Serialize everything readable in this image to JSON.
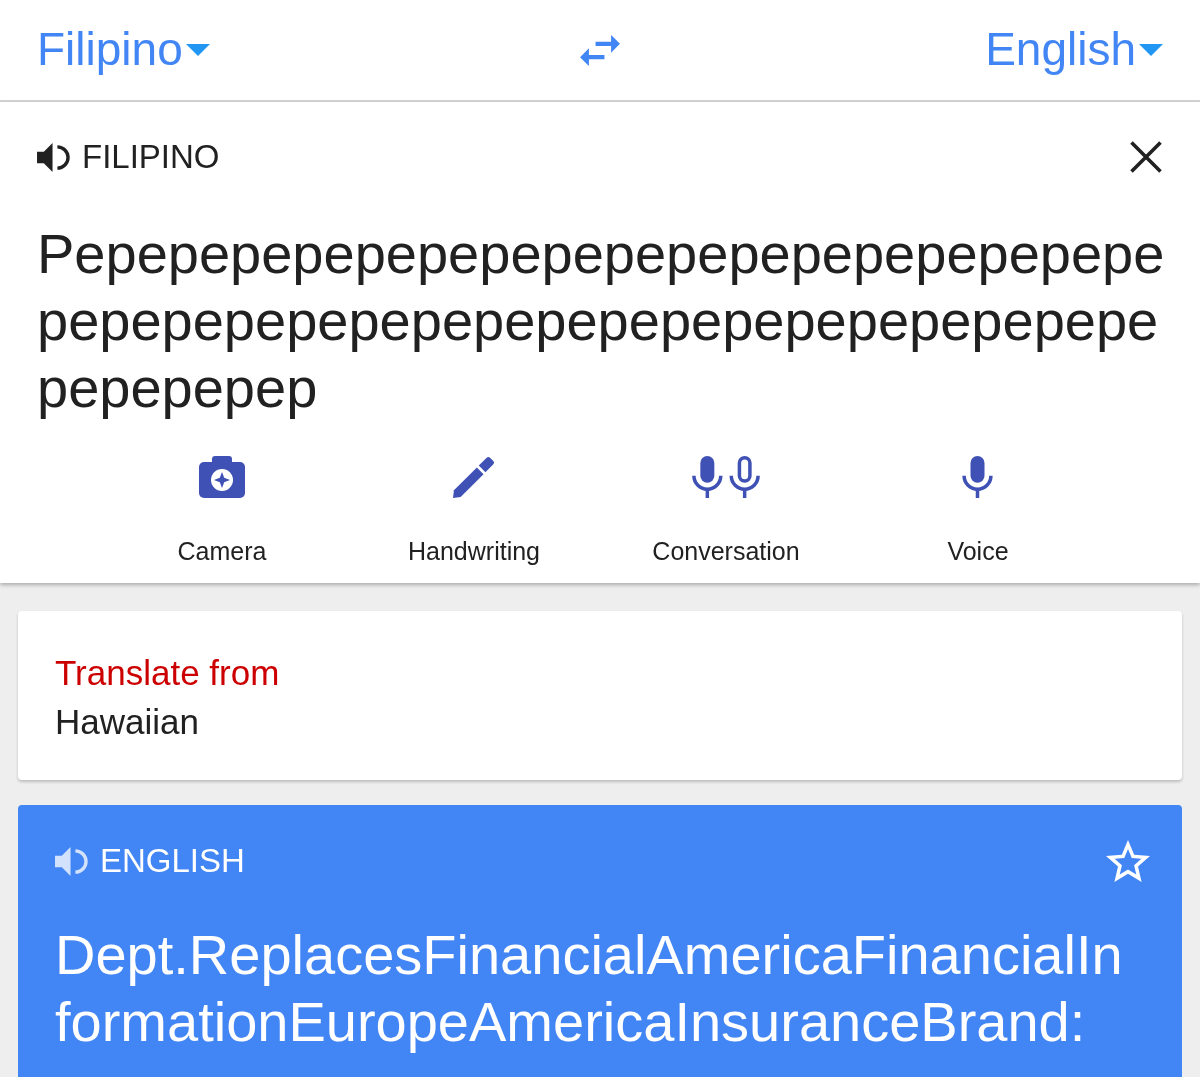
{
  "language_bar": {
    "source_language": "Filipino",
    "target_language": "English"
  },
  "source": {
    "language_label": "FILIPINO",
    "text": "Pepepepepepepepepepepepepepepepepepepepepepepepepepepepepepepepepepepepepepepepep"
  },
  "input_tools": [
    {
      "kind": "camera",
      "label": "Camera"
    },
    {
      "kind": "handwriting",
      "label": "Handwriting"
    },
    {
      "kind": "conversation",
      "label": "Conversation"
    },
    {
      "kind": "voice",
      "label": "Voice"
    }
  ],
  "suggestion": {
    "title": "Translate from",
    "language": "Hawaiian"
  },
  "translation": {
    "language_label": "ENGLISH",
    "starred": false,
    "text": "Dept.ReplacesFinancialAmericaFinancialInformationEuropeAmericaInsuranceBrand:"
  }
}
